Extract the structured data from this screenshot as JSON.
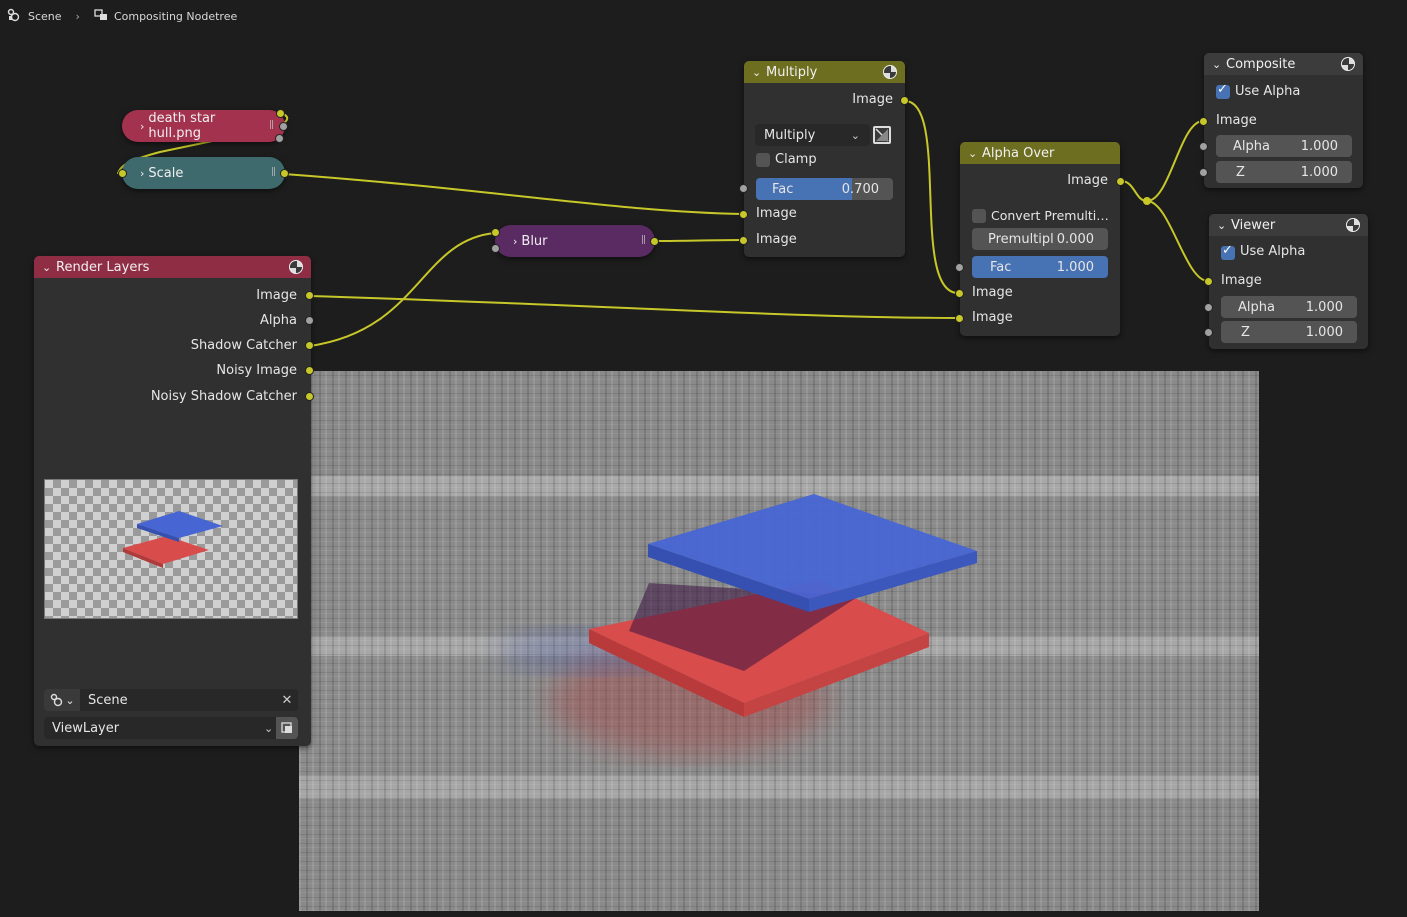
{
  "breadcrumb": {
    "scene": "Scene",
    "tree": "Compositing Nodetree"
  },
  "collapsed_nodes": {
    "image": "death star hull.png",
    "scale": "Scale",
    "blur": "Blur"
  },
  "render_layers": {
    "title": "Render Layers",
    "outputs": [
      "Image",
      "Alpha",
      "Shadow Catcher",
      "Noisy Image",
      "Noisy Shadow Catcher"
    ],
    "scene": "Scene",
    "view_layer": "ViewLayer"
  },
  "multiply": {
    "title": "Multiply",
    "output": "Image",
    "mode": "Multiply",
    "clamp": "Clamp",
    "fac_label": "Fac",
    "fac_value": "0.700",
    "fac_fraction": 0.7,
    "input1": "Image",
    "input2": "Image"
  },
  "alpha_over": {
    "title": "Alpha Over",
    "output": "Image",
    "convert": "Convert Premulti…",
    "premul_label": "Premultipl",
    "premul_value": "0.000",
    "fac_label": "Fac",
    "fac_value": "1.000",
    "input1": "Image",
    "input2": "Image"
  },
  "composite": {
    "title": "Composite",
    "use_alpha": "Use Alpha",
    "input": "Image",
    "alpha_label": "Alpha",
    "alpha_value": "1.000",
    "z_label": "Z",
    "z_value": "1.000"
  },
  "viewer": {
    "title": "Viewer",
    "use_alpha": "Use Alpha",
    "input": "Image",
    "alpha_label": "Alpha",
    "alpha_value": "1.000",
    "z_label": "Z",
    "z_value": "1.000"
  },
  "colors": {
    "header_red": "#8f2d45",
    "header_olive": "#6e6e20",
    "header_dark": "#3c3c3c",
    "image_node": "#a3324f",
    "scale_node": "#3e6a6e",
    "blur_node": "#5a2a63",
    "wire": "#c7c729",
    "accent_blue": "#4772b3"
  }
}
